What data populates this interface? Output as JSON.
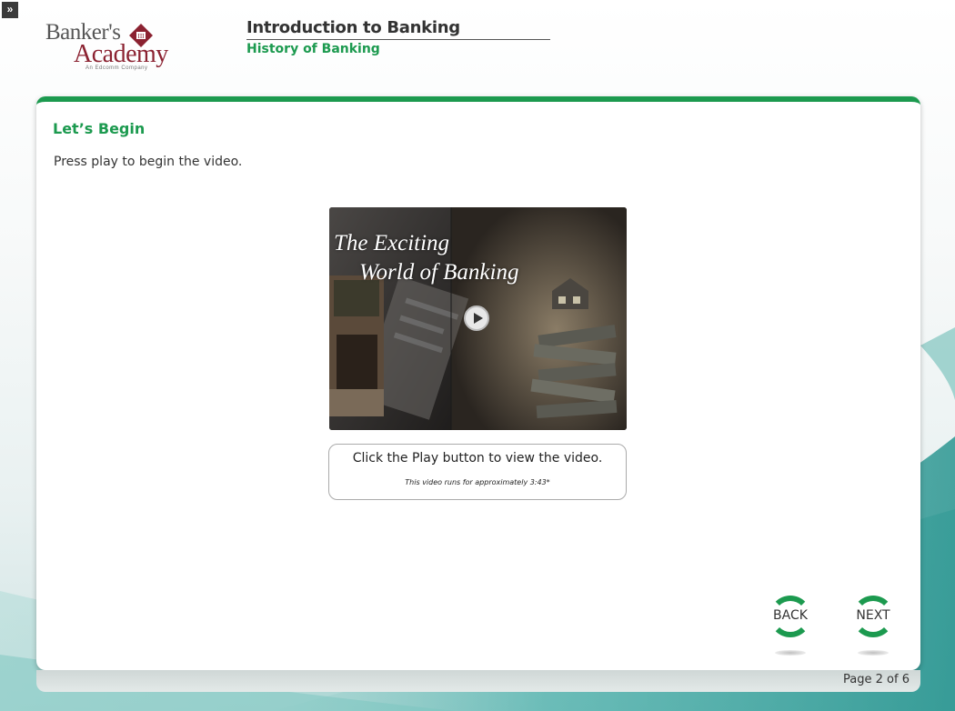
{
  "nav": {
    "expand_glyph": "»"
  },
  "logo": {
    "line1": "Banker's",
    "line2": "Academy",
    "tagline": "An Edcomm Company",
    "emblem_text": "III",
    "brand_color": "#8b2231"
  },
  "header": {
    "course_title": "Introduction to Banking",
    "module_title": "History of Banking"
  },
  "content": {
    "heading": "Let’s Begin",
    "instruction": "Press play to begin the video."
  },
  "video": {
    "title_line1": "The Exciting",
    "title_line2": "World of Banking",
    "caption": "Click the Play button to view the video.",
    "duration_note": "This video runs for approximately 3:43*"
  },
  "navigation": {
    "back_label": "BACK",
    "next_label": "NEXT"
  },
  "footer": {
    "page_indicator": "Page 2 of  6"
  },
  "colors": {
    "accent": "#1c9a4f",
    "text": "#333333"
  },
  "icons": {
    "expand": "double-chevron-right-icon",
    "play": "play-icon",
    "emblem": "diamond-emblem-icon"
  }
}
